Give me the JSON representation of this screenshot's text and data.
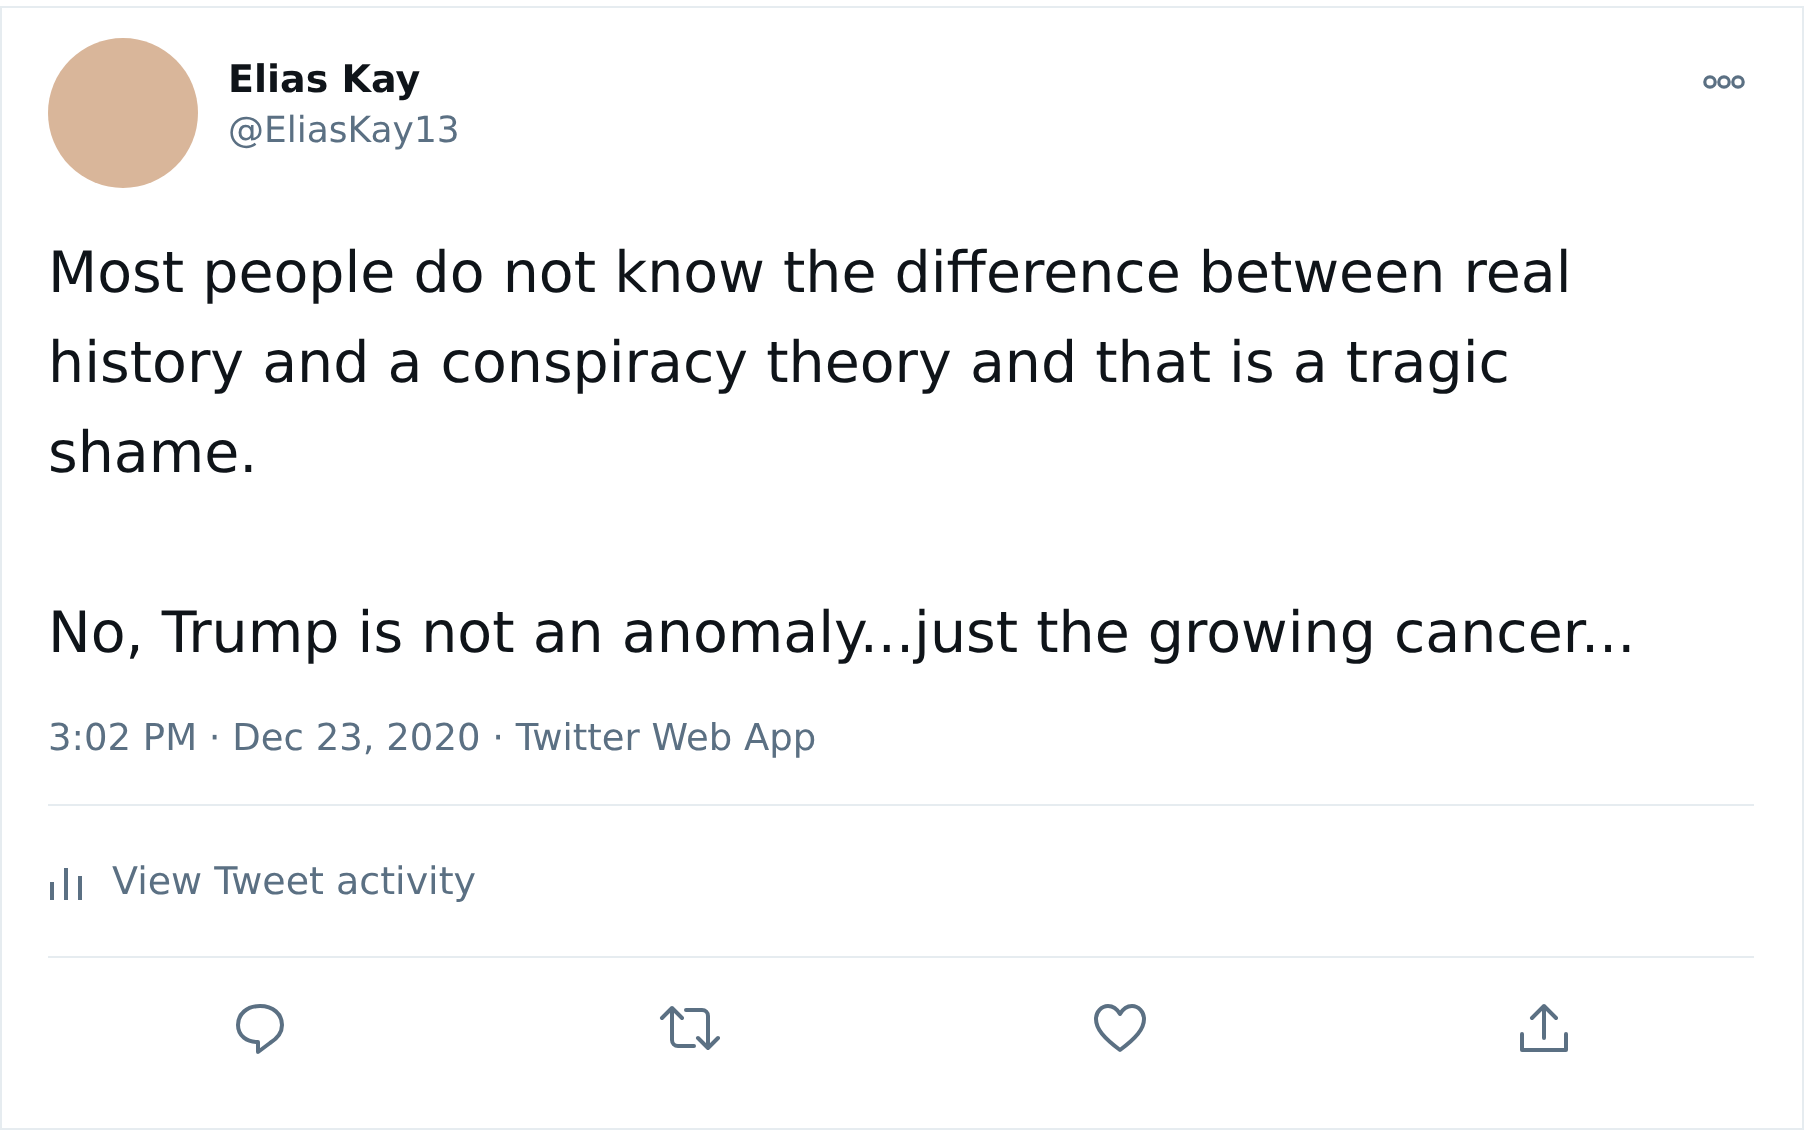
{
  "author": {
    "name": "Elias Kay",
    "handle": "@EliasKay13"
  },
  "paragraphs": [
    "Most people do not know the difference between real history and a conspiracy theory and that is a tragic shame.",
    "No, Trump is not an anomaly...just the growing cancer..."
  ],
  "meta": "3:02 PM · Dec 23, 2020 · Twitter Web App",
  "activity": "View Tweet activity",
  "actions": [
    {
      "kind": "reply"
    },
    {
      "kind": "retweet"
    },
    {
      "kind": "like"
    },
    {
      "kind": "share"
    }
  ]
}
